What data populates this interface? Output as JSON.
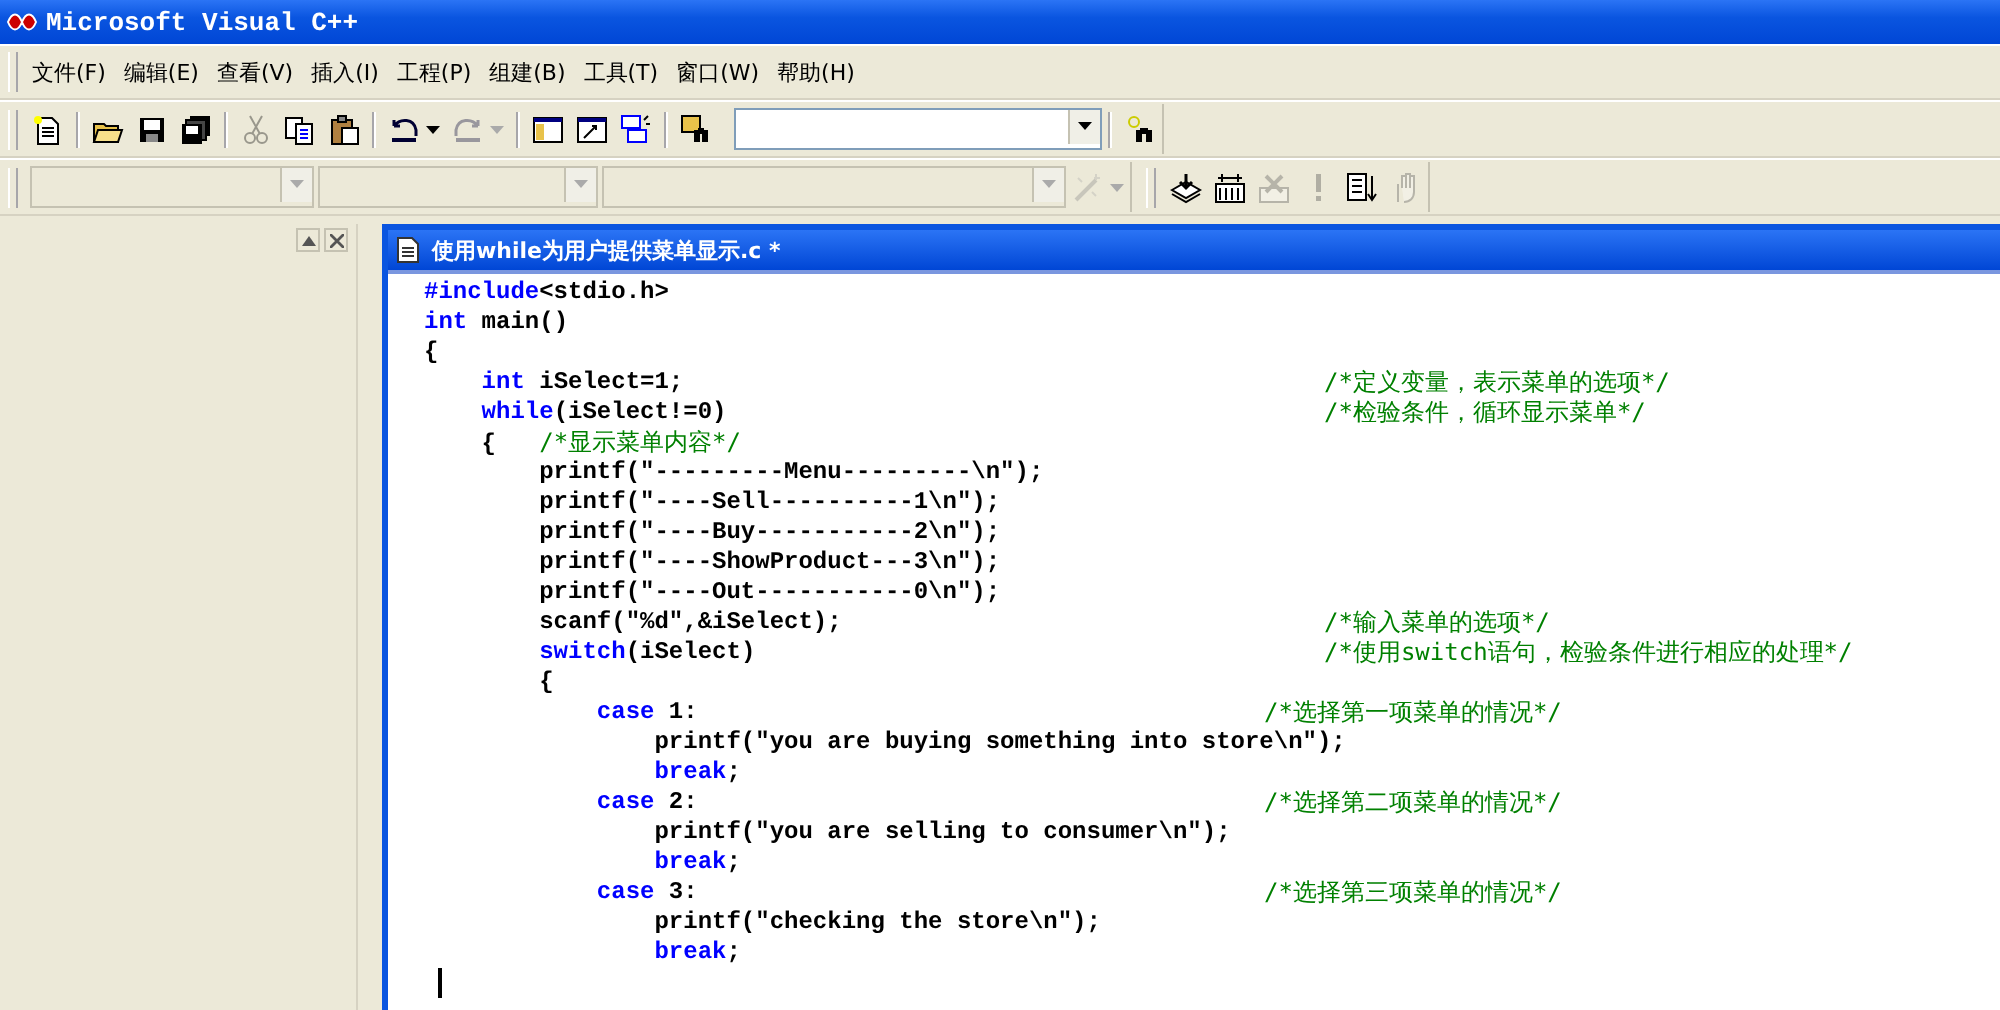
{
  "window": {
    "title": "Microsoft Visual C++"
  },
  "menu": [
    "文件(F)",
    "编辑(E)",
    "查看(V)",
    "插入(I)",
    "工程(P)",
    "组建(B)",
    "工具(T)",
    "窗口(W)",
    "帮助(H)"
  ],
  "toolbar_standard": [
    {
      "kind": "new",
      "disabled": false
    },
    {
      "kind": "separator"
    },
    {
      "kind": "open",
      "disabled": false
    },
    {
      "kind": "save",
      "disabled": false
    },
    {
      "kind": "saveall",
      "disabled": false
    },
    {
      "kind": "separator"
    },
    {
      "kind": "cut",
      "disabled": true
    },
    {
      "kind": "copy",
      "disabled": false
    },
    {
      "kind": "paste",
      "disabled": false
    },
    {
      "kind": "separator"
    },
    {
      "kind": "undo",
      "disabled": false
    },
    {
      "kind": "redo",
      "disabled": true
    },
    {
      "kind": "separator"
    },
    {
      "kind": "workspace",
      "disabled": false
    },
    {
      "kind": "output",
      "disabled": false
    },
    {
      "kind": "windows",
      "disabled": false
    },
    {
      "kind": "separator"
    },
    {
      "kind": "findfiles",
      "disabled": false
    }
  ],
  "toolbar_build": [
    {
      "kind": "compile",
      "disabled": false
    },
    {
      "kind": "build",
      "disabled": false
    },
    {
      "kind": "stop",
      "disabled": true
    },
    {
      "kind": "execute",
      "disabled": true
    },
    {
      "kind": "go",
      "disabled": false
    },
    {
      "kind": "breakpoint",
      "disabled": true
    }
  ],
  "editor": {
    "title": "使用while为用户提供菜单显示.c *",
    "lines": [
      {
        "tokens": [
          {
            "kind": "keyword",
            "text": "#include"
          },
          {
            "kind": "plain",
            "text": "<stdio.h>"
          }
        ]
      },
      {
        "tokens": [
          {
            "kind": "keyword",
            "text": "int"
          },
          {
            "kind": "plain",
            "text": " main()"
          }
        ]
      },
      {
        "tokens": [
          {
            "kind": "plain",
            "text": "{"
          }
        ]
      },
      {
        "tokens": [
          {
            "kind": "keyword",
            "text": "    int"
          },
          {
            "kind": "plain",
            "text": " iSelect=1;"
          }
        ],
        "comment": "/*定义变量，表示菜单的选项*/"
      },
      {
        "tokens": [
          {
            "kind": "keyword",
            "text": "    while"
          },
          {
            "kind": "plain",
            "text": "(iSelect!=0)"
          }
        ],
        "comment": "/*检验条件，循环显示菜单*/"
      },
      {
        "tokens": [
          {
            "kind": "plain",
            "text": "    {   "
          },
          {
            "kind": "comment",
            "text": "/*显示菜单内容*/"
          }
        ]
      },
      {
        "tokens": [
          {
            "kind": "plain",
            "text": "        printf(\"---------Menu---------\\n\");"
          }
        ]
      },
      {
        "tokens": [
          {
            "kind": "plain",
            "text": "        printf(\"----Sell----------1\\n\");"
          }
        ]
      },
      {
        "tokens": [
          {
            "kind": "plain",
            "text": "        printf(\"----Buy-----------2\\n\");"
          }
        ]
      },
      {
        "tokens": [
          {
            "kind": "plain",
            "text": "        printf(\"----ShowProduct---3\\n\");"
          }
        ]
      },
      {
        "tokens": [
          {
            "kind": "plain",
            "text": "        printf(\"----Out-----------0\\n\");"
          }
        ]
      },
      {
        "tokens": [
          {
            "kind": "plain",
            "text": "        scanf(\"%d\",&iSelect);"
          }
        ],
        "comment": "/*输入菜单的选项*/"
      },
      {
        "tokens": [
          {
            "kind": "keyword",
            "text": "        switch"
          },
          {
            "kind": "plain",
            "text": "(iSelect)"
          }
        ],
        "comment": "/*使用switch语句，检验条件进行相应的处理*/"
      },
      {
        "tokens": [
          {
            "kind": "plain",
            "text": "        {"
          }
        ]
      },
      {
        "tokens": [
          {
            "kind": "keyword",
            "text": "            case"
          },
          {
            "kind": "plain",
            "text": " 1:"
          }
        ],
        "comment": "/*选择第一项菜单的情况*/"
      },
      {
        "tokens": [
          {
            "kind": "plain",
            "text": "                printf(\"you are buying something into store\\n\");"
          }
        ]
      },
      {
        "tokens": [
          {
            "kind": "keyword",
            "text": "                break"
          },
          {
            "kind": "plain",
            "text": ";"
          }
        ]
      },
      {
        "tokens": [
          {
            "kind": "keyword",
            "text": "            case"
          },
          {
            "kind": "plain",
            "text": " 2:"
          }
        ],
        "comment": "/*选择第二项菜单的情况*/"
      },
      {
        "tokens": [
          {
            "kind": "plain",
            "text": "                printf(\"you are selling to consumer\\n\");"
          }
        ]
      },
      {
        "tokens": [
          {
            "kind": "keyword",
            "text": "                break"
          },
          {
            "kind": "plain",
            "text": ";"
          }
        ]
      },
      {
        "tokens": [
          {
            "kind": "keyword",
            "text": "            case"
          },
          {
            "kind": "plain",
            "text": " 3:"
          }
        ],
        "comment": "/*选择第三项菜单的情况*/"
      },
      {
        "tokens": [
          {
            "kind": "plain",
            "text": "                printf(\"checking the store\\n\");"
          }
        ]
      },
      {
        "tokens": [
          {
            "kind": "keyword",
            "text": "                break"
          },
          {
            "kind": "plain",
            "text": ";"
          }
        ]
      },
      {
        "cursor": true
      }
    ]
  }
}
